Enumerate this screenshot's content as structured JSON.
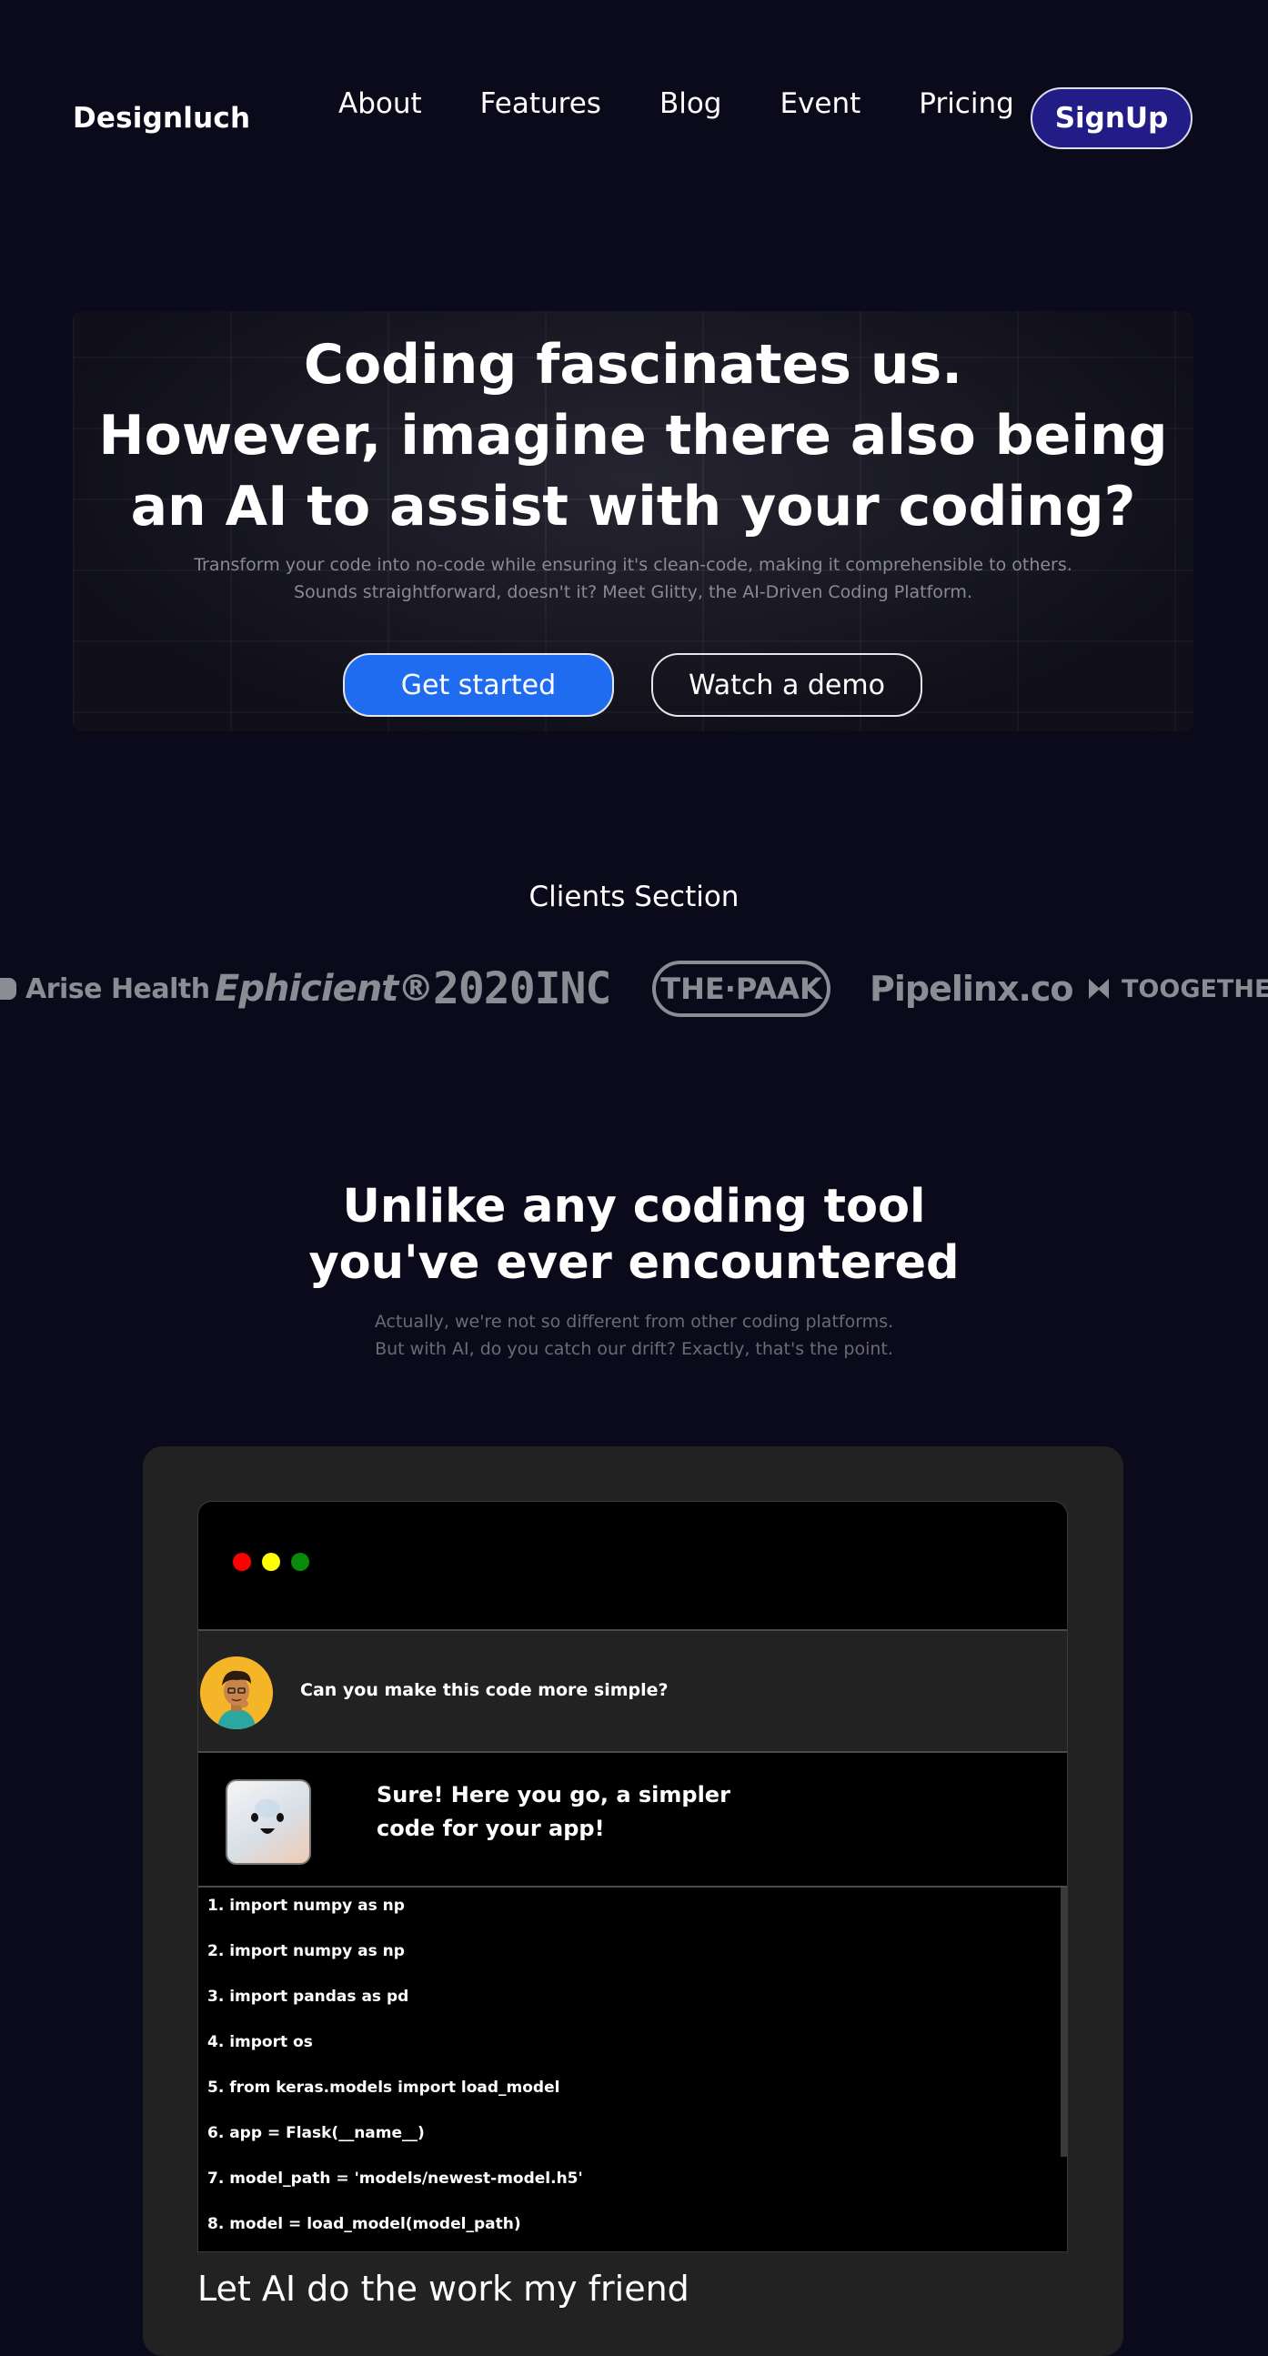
{
  "nav": {
    "brand": "Designluch",
    "links": [
      "About",
      "Features",
      "Blog",
      "Event",
      "Pricing"
    ],
    "signup_label": "SignUp"
  },
  "hero": {
    "title_lines": [
      "Coding fascinates us.",
      "However, imagine there also being",
      "an AI to assist with your coding?"
    ],
    "subtitle_lines": [
      "Transform your code into no-code while ensuring it's clean-code, making it comprehensible to others.",
      "Sounds straightforward, doesn't it? Meet Glitty, the AI-Driven Coding Platform."
    ],
    "primary_button": "Get started",
    "secondary_button": "Watch a demo"
  },
  "clients": {
    "title": "Clients Section",
    "logos": [
      "Arise Health",
      "Ephicient®",
      "2020INC",
      "THE·PAAK",
      "Pipelinx.co",
      "TOOGETHER"
    ]
  },
  "features": {
    "title_lines": [
      "Unlike any coding tool",
      "you've ever encountered"
    ],
    "subtitle_lines": [
      "Actually, we're not so different from other coding platforms.",
      "But with AI, do you catch our drift? Exactly, that's the point."
    ],
    "window_dots": [
      "#ff0000",
      "#ffff00",
      "#0a8a0a"
    ],
    "user_message": "Can you make this code more simple?",
    "ai_message": "Sure! Here you go, a simpler code for your app!",
    "code_lines": [
      "1. import numpy as np",
      "2. import numpy as np",
      "3. import pandas as pd",
      "4. import os",
      "5. from keras.models import load_model",
      "6. app = Flask(__name__)",
      "7. model_path = 'models/newest-model.h5'",
      "8. model = load_model(model_path)"
    ],
    "footer": "Let AI do the work my friend"
  },
  "colors": {
    "background": "#0b0a1a",
    "signup_bg": "#221c86",
    "primary_button": "#1f6cf0",
    "logo_gray": "#8c8c94"
  }
}
